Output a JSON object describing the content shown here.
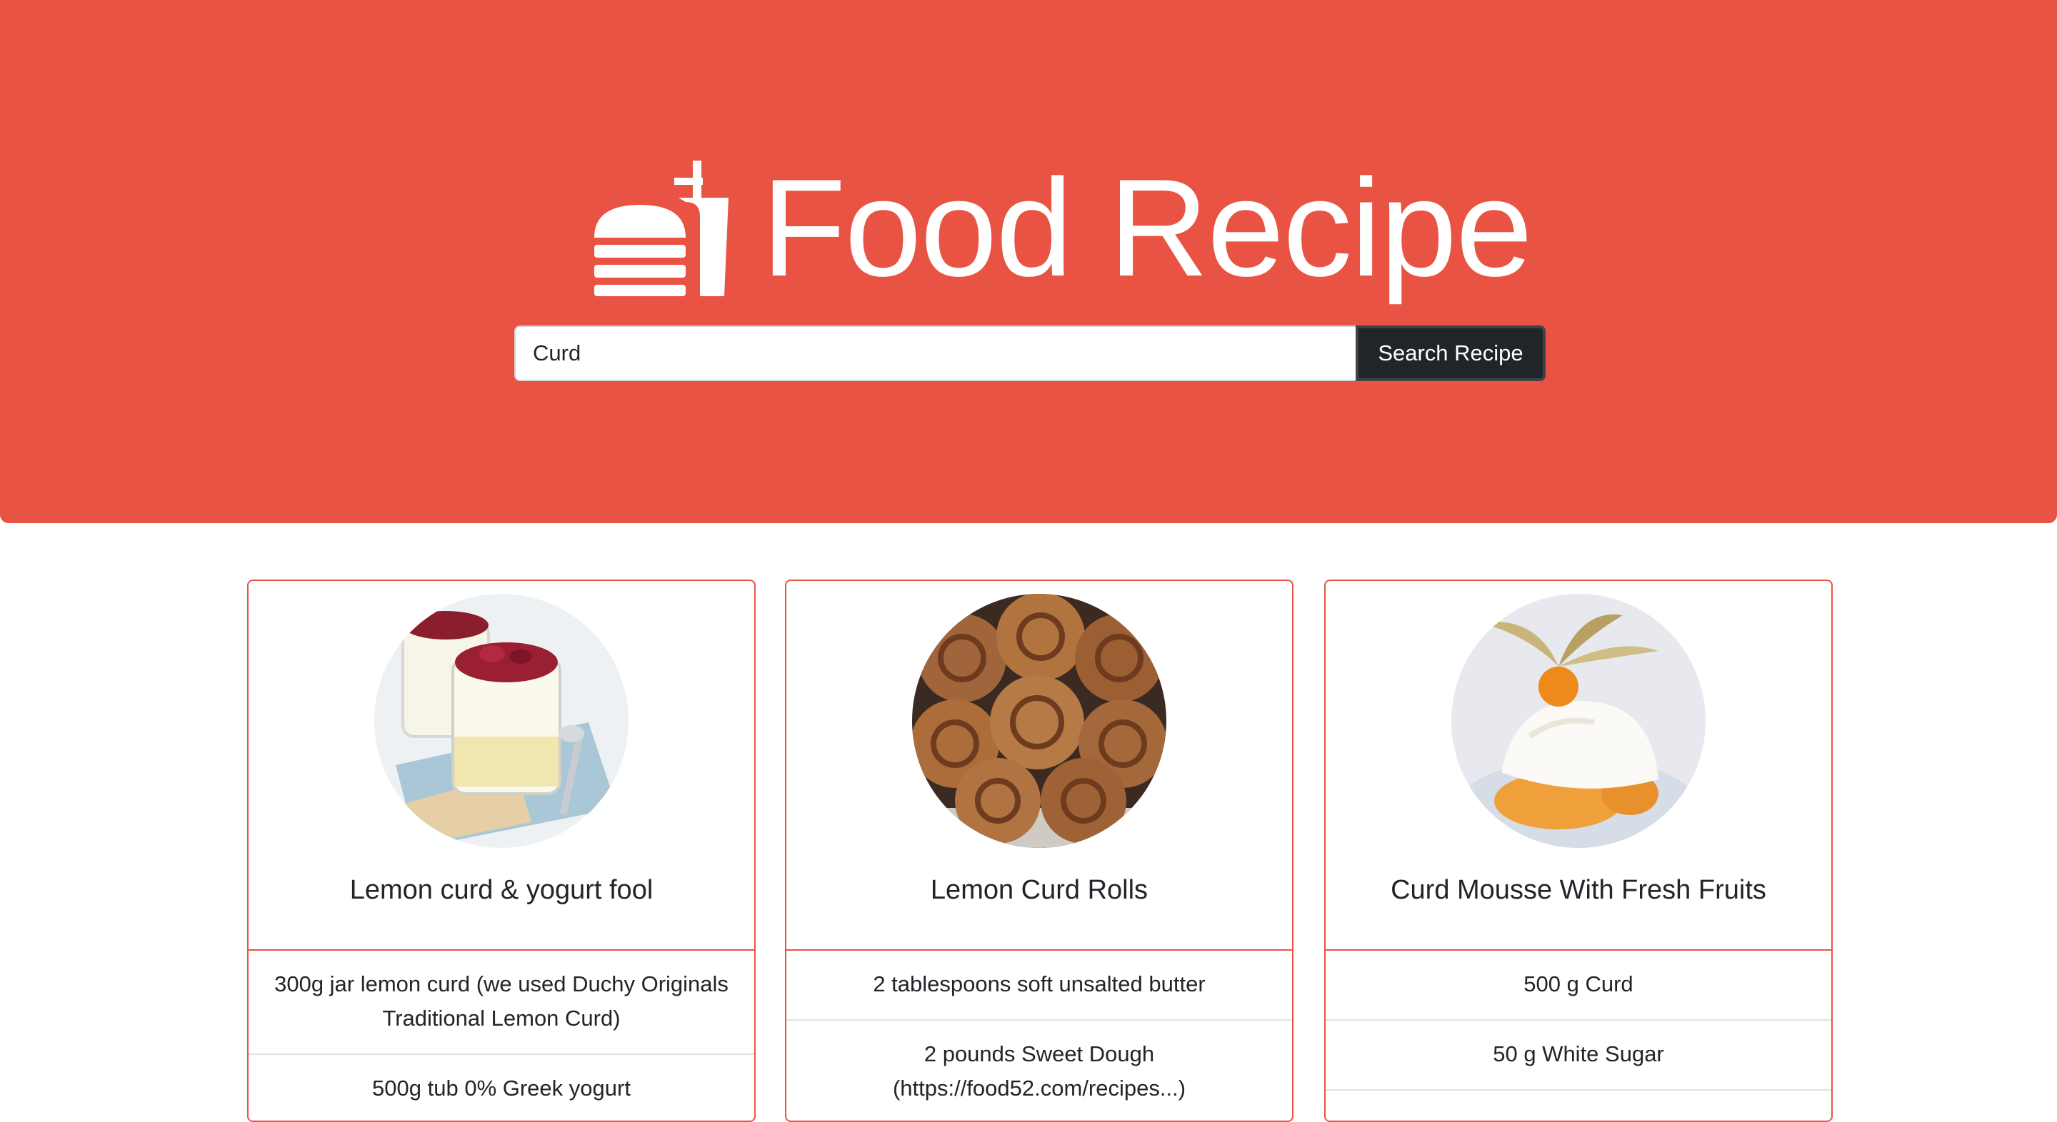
{
  "header": {
    "title": "Food Recipe",
    "logo_icon": "burger-drink-icon",
    "background_color": "#e95343"
  },
  "search": {
    "value": "Curd",
    "button_label": "Search Recipe"
  },
  "recipes": [
    {
      "title": "Lemon curd & yogurt fool",
      "image_icon": "lemon-curd-fool-image",
      "ingredients": [
        "300g jar lemon curd (we used Duchy Originals Traditional Lemon Curd)",
        "500g tub 0% Greek yogurt"
      ]
    },
    {
      "title": "Lemon Curd Rolls",
      "image_icon": "lemon-curd-rolls-image",
      "ingredients": [
        "2 tablespoons soft unsalted butter",
        "2 pounds Sweet Dough (https://food52.com/recipes...)"
      ]
    },
    {
      "title": "Curd Mousse With Fresh Fruits",
      "image_icon": "curd-mousse-image",
      "ingredients": [
        "500 g Curd",
        "50 g White Sugar",
        ""
      ]
    }
  ]
}
